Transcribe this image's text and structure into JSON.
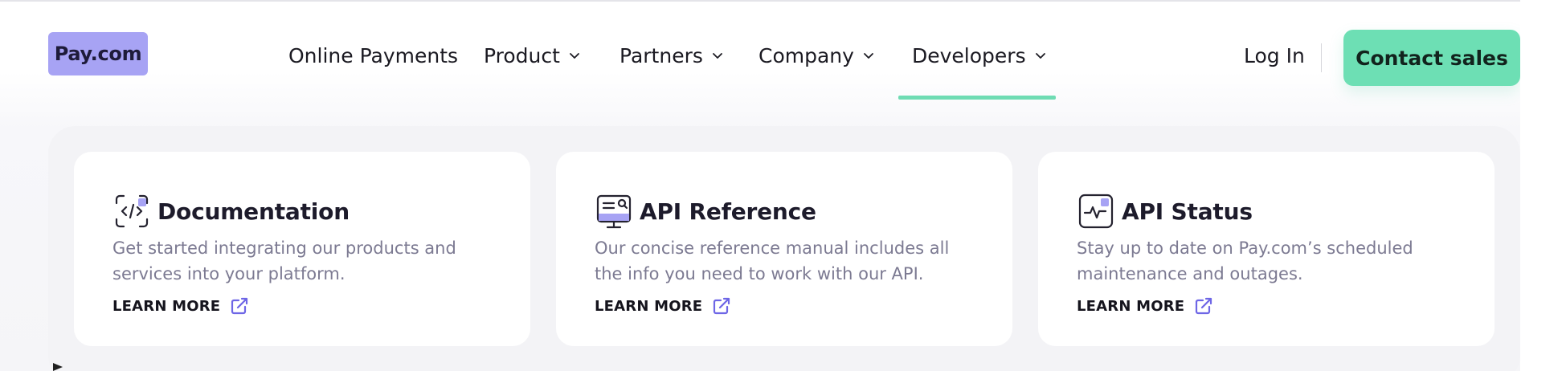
{
  "brand": {
    "logo_text": "Pay.com",
    "accent": "#6ddfb4",
    "logo_bg": "#a7a3f4"
  },
  "nav": {
    "items": [
      {
        "label": "Online Payments",
        "has_dropdown": false
      },
      {
        "label": "Product",
        "has_dropdown": true
      },
      {
        "label": "Partners",
        "has_dropdown": true
      },
      {
        "label": "Company",
        "has_dropdown": true
      },
      {
        "label": "Developers",
        "has_dropdown": true,
        "active": true
      }
    ],
    "login_label": "Log In",
    "cta_label": "Contact sales"
  },
  "developers_menu": {
    "cards": [
      {
        "icon": "code-icon",
        "title": "Documentation",
        "description": "Get started integrating our products and services into your platform.",
        "link_label": "LEARN MORE"
      },
      {
        "icon": "api-reference-icon",
        "title": "API Reference",
        "description": "Our concise reference manual includes all the info you need to work with our API.",
        "link_label": "LEARN MORE"
      },
      {
        "icon": "status-pulse-icon",
        "title": "API Status",
        "description": "Stay up to date on Pay.com’s scheduled maintenance and outages.",
        "link_label": "LEARN MORE"
      }
    ]
  }
}
